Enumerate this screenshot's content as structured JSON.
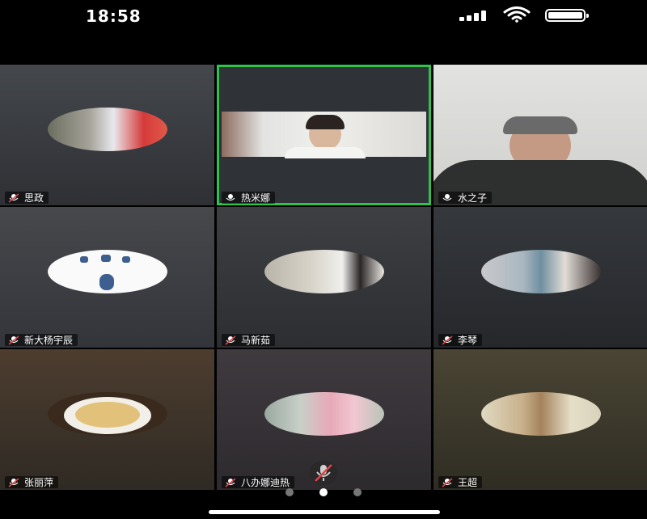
{
  "status_bar": {
    "time": "18:58"
  },
  "participants": [
    {
      "name": "思政",
      "mic": "muted",
      "video": false,
      "avatar": "balloons-photo",
      "bg": "#3a3d42"
    },
    {
      "name": "热米娜",
      "mic": "on",
      "video": true,
      "avatar": "woman-video",
      "bg": "#2f3237",
      "active": true
    },
    {
      "name": "水之子",
      "mic": "on",
      "video": true,
      "avatar": "man-video",
      "bg": "#d8d8d6"
    },
    {
      "name": "新大杨宇辰",
      "mic": "muted",
      "video": false,
      "avatar": "blue-figures-drawing",
      "bg": "#3c3e42"
    },
    {
      "name": "马新茹",
      "mic": "muted",
      "video": false,
      "avatar": "woman-photo",
      "bg": "#34373b"
    },
    {
      "name": "李琴",
      "mic": "muted",
      "video": false,
      "avatar": "woman-hat-photo",
      "bg": "#2c2f33"
    },
    {
      "name": "张丽萍",
      "mic": "muted",
      "video": false,
      "avatar": "teacup-photo",
      "bg": "#4a3c30"
    },
    {
      "name": "八办娜迪热",
      "mic": "muted",
      "video": false,
      "avatar": "pink-flower-photo",
      "bg": "#3a353a"
    },
    {
      "name": "王超",
      "mic": "muted",
      "video": false,
      "avatar": "woman-profile-photo",
      "bg": "#3e3a30"
    }
  ],
  "pager": {
    "pages": 3,
    "current": 2
  },
  "colors": {
    "active_border": "#2ec24f",
    "muted_icon": "#e0444a"
  }
}
